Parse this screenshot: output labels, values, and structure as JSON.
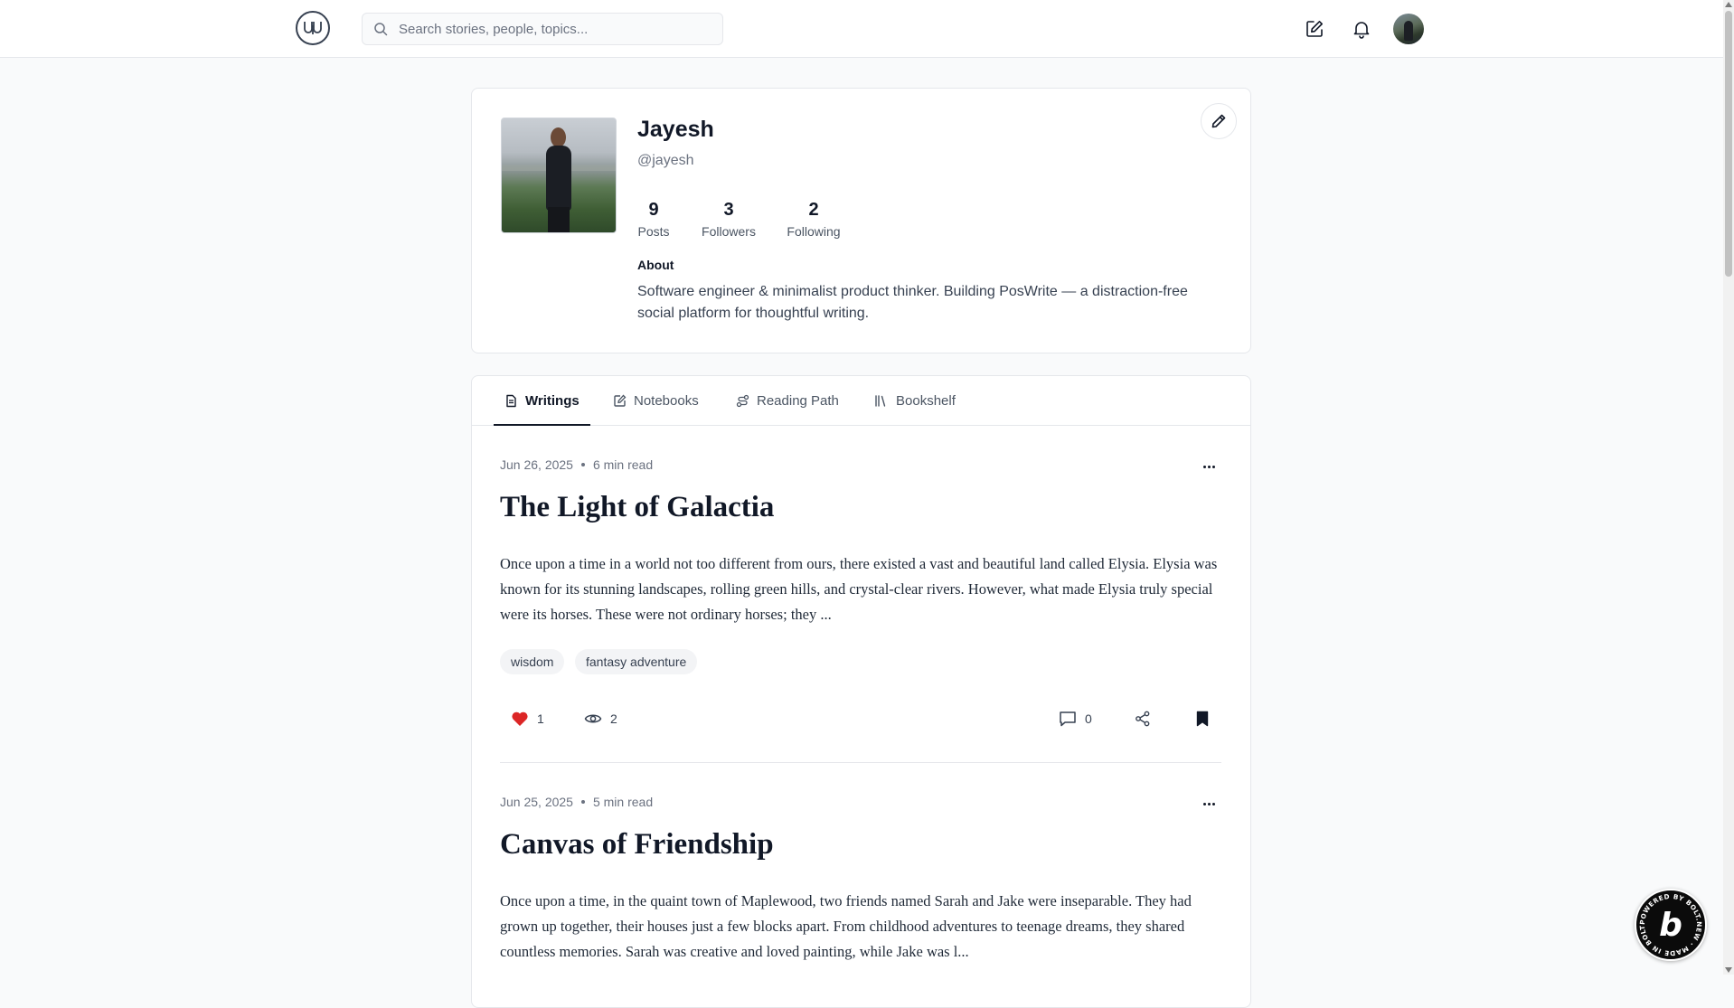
{
  "header": {
    "logo_text": "UƏ",
    "search_placeholder": "Search stories, people, topics..."
  },
  "profile": {
    "name": "Jayesh",
    "handle": "@jayesh",
    "stats": [
      {
        "value": "9",
        "label": "Posts"
      },
      {
        "value": "3",
        "label": "Followers"
      },
      {
        "value": "2",
        "label": "Following"
      }
    ],
    "about_heading": "About",
    "about_text": "Software engineer & minimalist product thinker. Building PosWrite — a distraction-free social platform for thoughtful writing."
  },
  "tabs": [
    {
      "label": "Writings",
      "icon": "document-icon",
      "active": true
    },
    {
      "label": "Notebooks",
      "icon": "notebook-edit-icon",
      "active": false
    },
    {
      "label": "Reading Path",
      "icon": "route-icon",
      "active": false
    },
    {
      "label": "Bookshelf",
      "icon": "library-icon",
      "active": false
    }
  ],
  "posts": [
    {
      "date": "Jun 26, 2025",
      "read_time": "6 min read",
      "title": "The Light of Galactia",
      "excerpt": "Once upon a time in a world not too different from ours, there existed a vast and beautiful land called Elysia. Elysia was known for its stunning landscapes, rolling green hills, and crystal-clear rivers. However, what made Elysia truly special were its horses. These were not ordinary horses; they ...",
      "tags": [
        "wisdom",
        "fantasy adventure"
      ],
      "likes": "1",
      "views": "2",
      "comments": "0",
      "liked": true,
      "bookmarked": true
    },
    {
      "date": "Jun 25, 2025",
      "read_time": "5 min read",
      "title": "Canvas of Friendship",
      "excerpt": "Once upon a time, in the quaint town of Maplewood, two friends named Sarah and Jake were inseparable. They had grown up together, their houses just a few blocks apart. From childhood adventures to teenage dreams, they shared countless memories. Sarah was creative and loved painting, while Jake was l..."
    }
  ],
  "badge": {
    "letter": "b",
    "ring_text": "POWERED BY BOLT.NEW · MADE IN BOLT.NEW ·"
  },
  "colors": {
    "accent": "#111827",
    "like": "#dc2626",
    "page_bg": "#f9fafb"
  }
}
